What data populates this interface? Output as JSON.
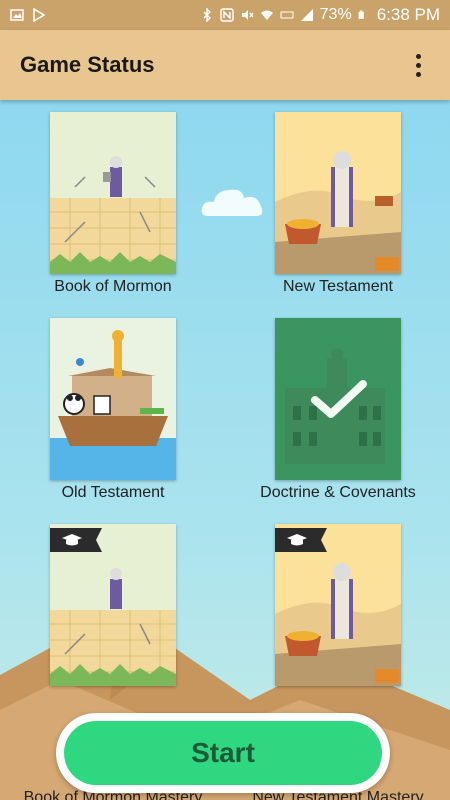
{
  "status_bar": {
    "battery": "73%",
    "time": "6:38 PM",
    "icons": [
      "image-icon",
      "play-store-icon",
      "bluetooth-icon",
      "nfc-icon",
      "mute-icon",
      "wifi-icon",
      "lte-icon",
      "signal-icon",
      "battery-icon"
    ]
  },
  "app_bar": {
    "title": "Game Status",
    "menu_icon": "more-vert-icon"
  },
  "cards": [
    {
      "label": "Book of Mormon",
      "theme": "book-of-mormon"
    },
    {
      "label": "New Testament",
      "theme": "new-testament"
    },
    {
      "label": "Old Testament",
      "theme": "old-testament"
    },
    {
      "label": "Doctrine & Covenants",
      "theme": "doctrine-covenants",
      "completed": true
    },
    {
      "label": "Book of Mormon Mastery",
      "theme": "book-of-mormon",
      "mastery": true
    },
    {
      "label": "New Testament Mastery",
      "theme": "new-testament",
      "mastery": true
    }
  ],
  "start_button": {
    "label": "Start"
  },
  "colors": {
    "status_bar": "#c9a36a",
    "app_bar": "#e9c690",
    "sky": "#8fd8ef",
    "start_green": "#2fd880",
    "check_overlay": "#2a8a54"
  }
}
